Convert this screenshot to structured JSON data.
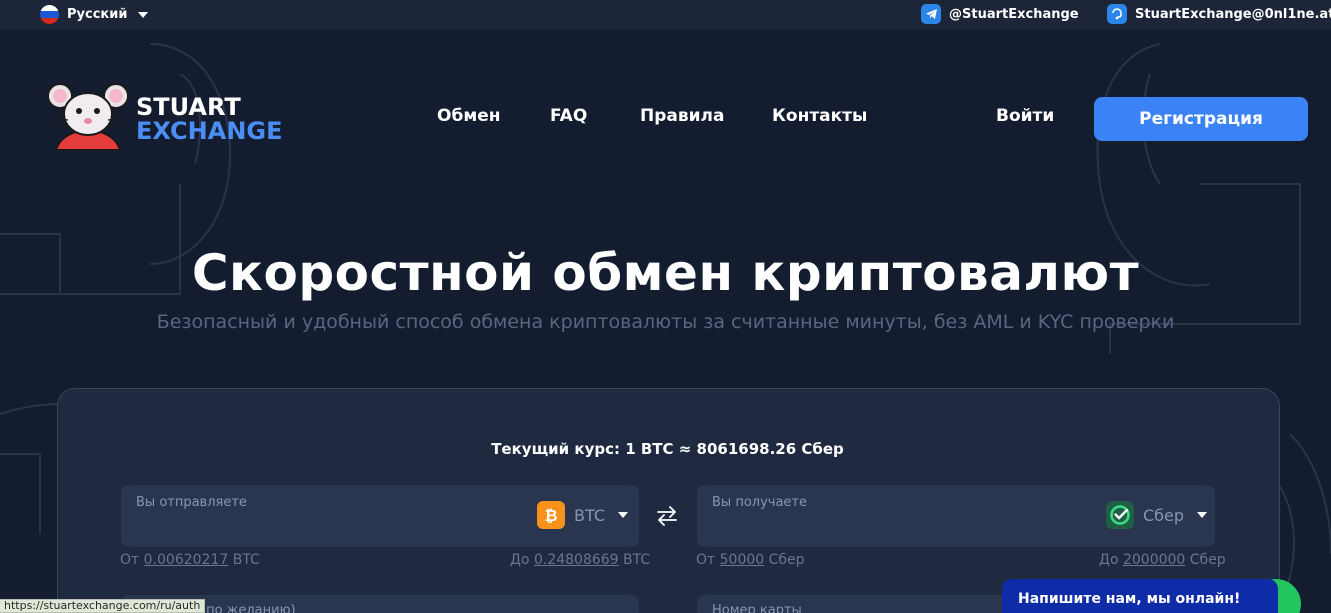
{
  "topbar": {
    "language": "Русский",
    "telegram": "@StuartExchange",
    "email": "StuartExchange@0nl1ne.at"
  },
  "brand": {
    "line1": "STUART",
    "line2": "EXCHANGE",
    "accent": "#4a8ef3"
  },
  "nav": {
    "exchange": "Обмен",
    "faq": "FAQ",
    "rules": "Правила",
    "contacts": "Контакты",
    "login": "Войти",
    "register": "Регистрация"
  },
  "hero": {
    "title": "Скоростной обмен криптовалют",
    "subtitle": "Безопасный и удобный способ обмена криптовалюты за считанные минуты, без AML и KYC проверки"
  },
  "exchange": {
    "rate": "Текущий курс: 1 BTC ≈ 8061698.26 Сбер",
    "send": {
      "label": "Вы отправляете",
      "currency": "BTC",
      "min_prefix": "От",
      "min_value": "0.00620217",
      "min_unit": "BTC",
      "max_prefix": "До",
      "max_value": "0.24808669",
      "max_unit": "BTC"
    },
    "receive": {
      "label": "Вы получаете",
      "currency": "Сбер",
      "min_prefix": "От",
      "min_value": "50000",
      "min_unit": "Сбер",
      "max_prefix": "До",
      "max_value": "2000000",
      "max_unit": "Сбер"
    },
    "field_left_partial": "(по желанию)",
    "field_right_partial": "Номер карты"
  },
  "status_url": "https://stuartexchange.com/ru/auth",
  "chat_label": "Напишите нам, мы онлайн!",
  "colors": {
    "primary": "#3b82f6",
    "bitcoin": "#f7931a",
    "sber": "#21a038",
    "chat": "#0f2ca8"
  }
}
